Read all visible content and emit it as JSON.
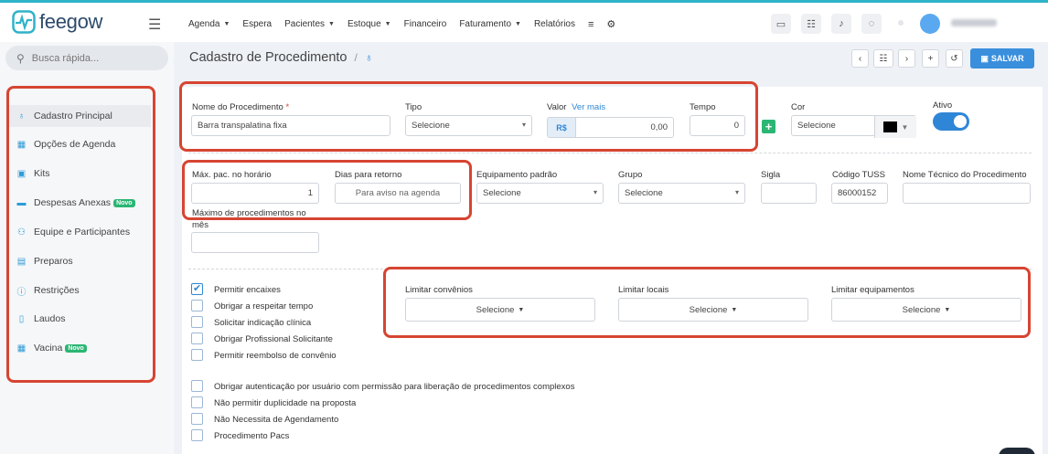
{
  "app": {
    "logo": "feegow"
  },
  "nav": [
    {
      "label": "Agenda",
      "dropdown": true
    },
    {
      "label": "Espera",
      "dropdown": false
    },
    {
      "label": "Pacientes",
      "dropdown": true
    },
    {
      "label": "Estoque",
      "dropdown": true
    },
    {
      "label": "Financeiro",
      "dropdown": false
    },
    {
      "label": "Faturamento",
      "dropdown": true
    },
    {
      "label": "Relatórios",
      "dropdown": false
    }
  ],
  "search": {
    "placeholder": "Busca rápida..."
  },
  "sidebar": [
    {
      "label": "Cadastro Principal",
      "icon": "stethoscope-icon",
      "badge": ""
    },
    {
      "label": "Opções de Agenda",
      "icon": "calendar-icon",
      "badge": ""
    },
    {
      "label": "Kits",
      "icon": "kit-icon",
      "badge": ""
    },
    {
      "label": "Despesas Anexas",
      "icon": "card-icon",
      "badge": "Novo"
    },
    {
      "label": "Equipe e Participantes",
      "icon": "team-icon",
      "badge": ""
    },
    {
      "label": "Preparos",
      "icon": "list-icon",
      "badge": ""
    },
    {
      "label": "Restrições",
      "icon": "restriction-icon",
      "badge": ""
    },
    {
      "label": "Laudos",
      "icon": "document-icon",
      "badge": ""
    },
    {
      "label": "Vacina",
      "icon": "calendar-icon",
      "badge": "Novo"
    }
  ],
  "page": {
    "title": "Cadastro de Procedimento",
    "sep": "/",
    "save": "SALVAR"
  },
  "form": {
    "nome_label": "Nome do Procedimento",
    "required": "*",
    "nome_value": "Barra transpalatina fixa",
    "tipo_label": "Tipo",
    "tipo_value": "Selecione",
    "valor_label": "Valor",
    "ver_mais": "Ver mais",
    "currency": "R$",
    "valor_value": "0,00",
    "tempo_label": "Tempo",
    "tempo_value": "0",
    "cor_label": "Cor",
    "cor_value": "Selecione",
    "cor_color": "#000000",
    "ativo_label": "Ativo",
    "max_label": "Máx. pac. no horário",
    "max_value": "1",
    "dias_label": "Dias para retorno",
    "dias_placeholder": "Para aviso na agenda",
    "equip_label": "Equipamento padrão",
    "equip_value": "Selecione",
    "grupo_label": "Grupo",
    "grupo_value": "Selecione",
    "sigla_label": "Sigla",
    "sigla_value": "",
    "tuss_label": "Código TUSS",
    "tuss_value": "86000152",
    "tecnico_label": "Nome Técnico do Procedimento",
    "tecnico_value": "",
    "maxmes_label_1": "Máximo de procedimentos no",
    "maxmes_label_2": "mês",
    "maxmes_value": "",
    "lim_conv_label": "Limitar convênios",
    "lim_conv_value": "Selecione",
    "lim_loc_label": "Limitar locais",
    "lim_loc_value": "Selecione",
    "lim_eq_label": "Limitar equipamentos",
    "lim_eq_value": "Selecione"
  },
  "checkboxes1": [
    {
      "label": "Permitir encaixes",
      "checked": true
    },
    {
      "label": "Obrigar a respeitar tempo",
      "checked": false
    },
    {
      "label": "Solicitar indicação clínica",
      "checked": false
    },
    {
      "label": "Obrigar Profissional Solicitante",
      "checked": false
    },
    {
      "label": "Permitir reembolso de convênio",
      "checked": false
    }
  ],
  "checkboxes2": [
    {
      "label": "Obrigar autenticação por usuário com permissão para liberação de procedimentos complexos",
      "checked": false
    },
    {
      "label": "Não permitir duplicidade na proposta",
      "checked": false
    },
    {
      "label": "Não Necessita de Agendamento",
      "checked": false
    },
    {
      "label": "Procedimento Pacs",
      "checked": false
    }
  ],
  "colors": {
    "accent": "#2f86d6",
    "highlight": "#d64532",
    "green": "#2bb673"
  }
}
